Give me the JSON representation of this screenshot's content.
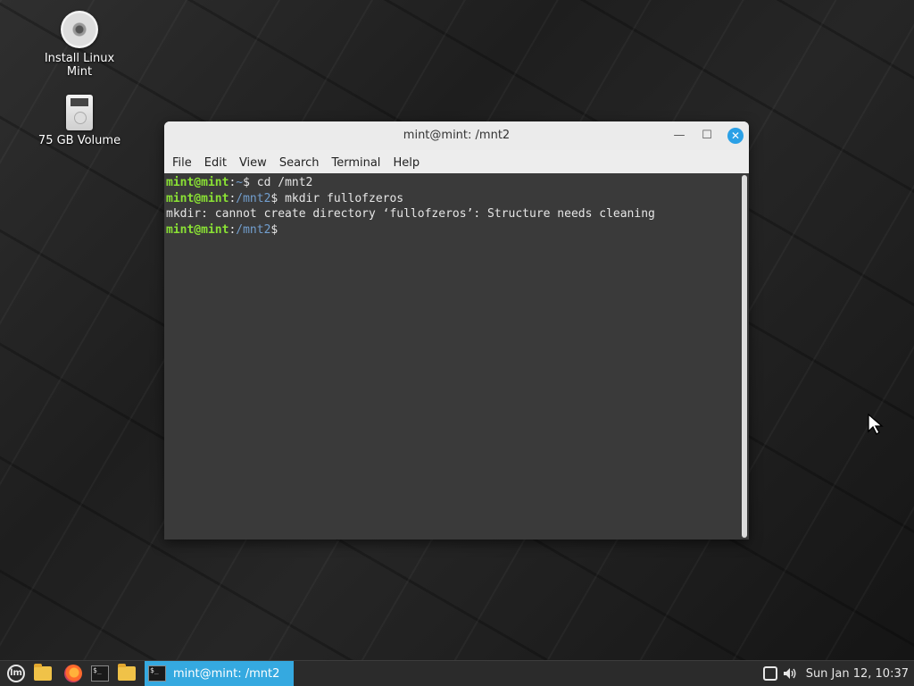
{
  "desktop": {
    "icons": [
      {
        "label": "Install Linux Mint",
        "icon": "cd-disc-icon"
      },
      {
        "label": "75 GB Volume",
        "icon": "drive-icon"
      }
    ]
  },
  "window": {
    "title": "mint@mint: /mnt2",
    "controls": {
      "minimize": "—",
      "maximize": "☐",
      "close": "✕"
    },
    "menu": [
      "File",
      "Edit",
      "View",
      "Search",
      "Terminal",
      "Help"
    ],
    "terminal": {
      "lines": [
        {
          "user": "mint@mint",
          "sep": ":",
          "path": "~",
          "prompt": "$ ",
          "cmd": "cd /mnt2"
        },
        {
          "user": "mint@mint",
          "sep": ":",
          "path": "/mnt2",
          "prompt": "$ ",
          "cmd": "mkdir fullofzeros"
        },
        {
          "output": "mkdir: cannot create directory ‘fullofzeros’: Structure needs cleaning"
        },
        {
          "user": "mint@mint",
          "sep": ":",
          "path": "/mnt2",
          "prompt": "$",
          "cmd": ""
        }
      ]
    }
  },
  "panel": {
    "menu_icon": "lm",
    "launchers": [
      "files-icon",
      "firefox-icon",
      "terminal-icon",
      "folder-icon"
    ],
    "task": {
      "label": "mint@mint: /mnt2"
    },
    "clock": "Sun Jan 12, 10:37"
  },
  "colors": {
    "prompt_user": "#8ae234",
    "prompt_path": "#729fcf",
    "accent": "#35a9e0"
  }
}
